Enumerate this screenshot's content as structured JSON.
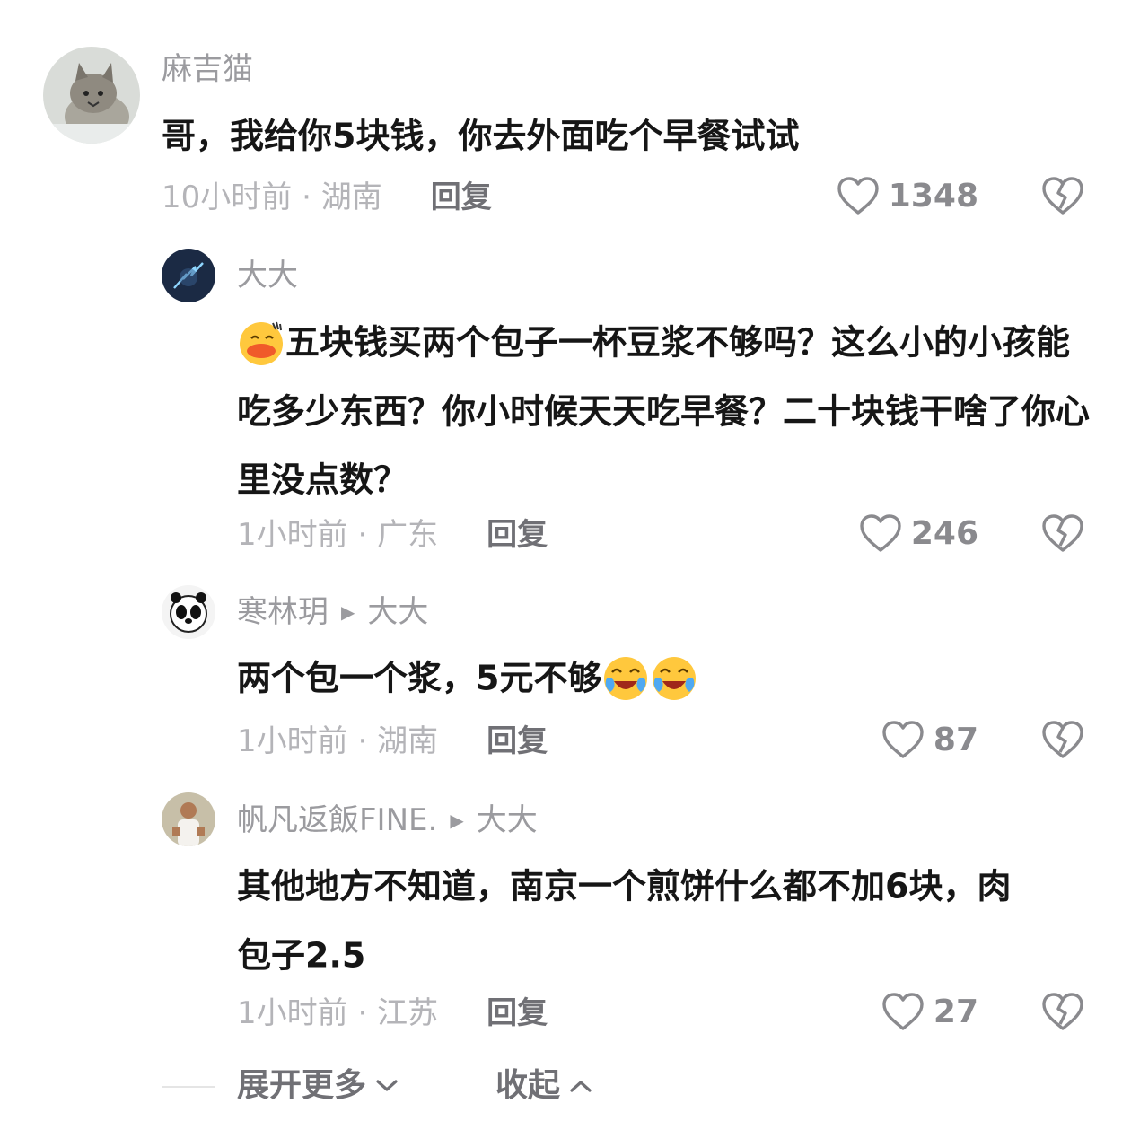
{
  "comments": [
    {
      "username": "麻吉猫",
      "text": "哥，我给你5块钱，你去外面吃个早餐试试",
      "time": "10小时前",
      "location": "湖南",
      "reply_label": "回复",
      "likes": "1348",
      "avatar_icon": "cat-avatar"
    },
    {
      "username": "大大",
      "text": "五块钱买两个包子一杯豆浆不够吗？这么小的小孩能吃多少东西？你小时候天天吃早餐？二十块钱干啥了你心里没点数？",
      "time": "1小时前",
      "location": "广东",
      "reply_label": "回复",
      "likes": "246",
      "avatar_icon": "lightning-avatar",
      "leading_emoji": "duck-face-emoji"
    },
    {
      "username": "寒林玥",
      "reply_to": "大大",
      "text": "两个包一个浆，5元不够",
      "time": "1小时前",
      "location": "湖南",
      "reply_label": "回复",
      "likes": "87",
      "avatar_icon": "panda-avatar",
      "trailing_emoji": "laugh-cry-emoji"
    },
    {
      "username": "帆凡返飯FINE.",
      "reply_to": "大大",
      "text": "其他地方不知道，南京一个煎饼什么都不加6块，肉包子2.5",
      "time": "1小时前",
      "location": "江苏",
      "reply_label": "回复",
      "likes": "27",
      "avatar_icon": "person-avatar"
    }
  ],
  "footer": {
    "expand_label": "展开更多",
    "collapse_label": "收起"
  },
  "colors": {
    "meta_gray": "#b4b4b8",
    "name_gray": "#9b9b9f",
    "text_dark": "#161616"
  }
}
